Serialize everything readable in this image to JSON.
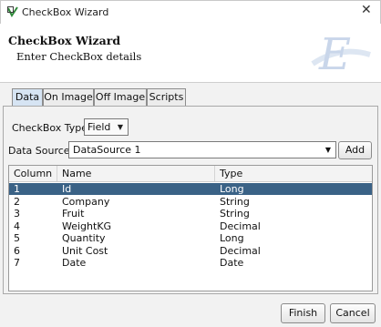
{
  "window": {
    "title": "CheckBox Wizard",
    "close_glyph": "✕"
  },
  "header": {
    "title": "CheckBox Wizard",
    "subtitle": "Enter CheckBox details",
    "logo_letter": "E"
  },
  "tabs": [
    {
      "label": "Data",
      "active": true
    },
    {
      "label": "On Image",
      "active": false
    },
    {
      "label": "Off Image",
      "active": false
    },
    {
      "label": "Scripts",
      "active": false
    }
  ],
  "form": {
    "checkbox_type_label": "CheckBox Type:",
    "checkbox_type_value": "Field",
    "data_source_label": "Data Source:",
    "data_source_value": "DataSource 1",
    "add_label": "Add",
    "dropdown_glyph": "▼"
  },
  "table": {
    "columns": [
      "Column",
      "Name",
      "Type"
    ],
    "rows": [
      [
        "1",
        "Id",
        "Long"
      ],
      [
        "2",
        "Company",
        "String"
      ],
      [
        "3",
        "Fruit",
        "String"
      ],
      [
        "4",
        "WeightKG",
        "Decimal"
      ],
      [
        "5",
        "Quantity",
        "Long"
      ],
      [
        "6",
        "Unit Cost",
        "Decimal"
      ],
      [
        "7",
        "Date",
        "Date"
      ]
    ],
    "selected_row": 0
  },
  "buttons": {
    "finish": "Finish",
    "cancel": "Cancel"
  },
  "colors": {
    "selection": "#3a6286",
    "active_tab": "#d6e4f3"
  }
}
